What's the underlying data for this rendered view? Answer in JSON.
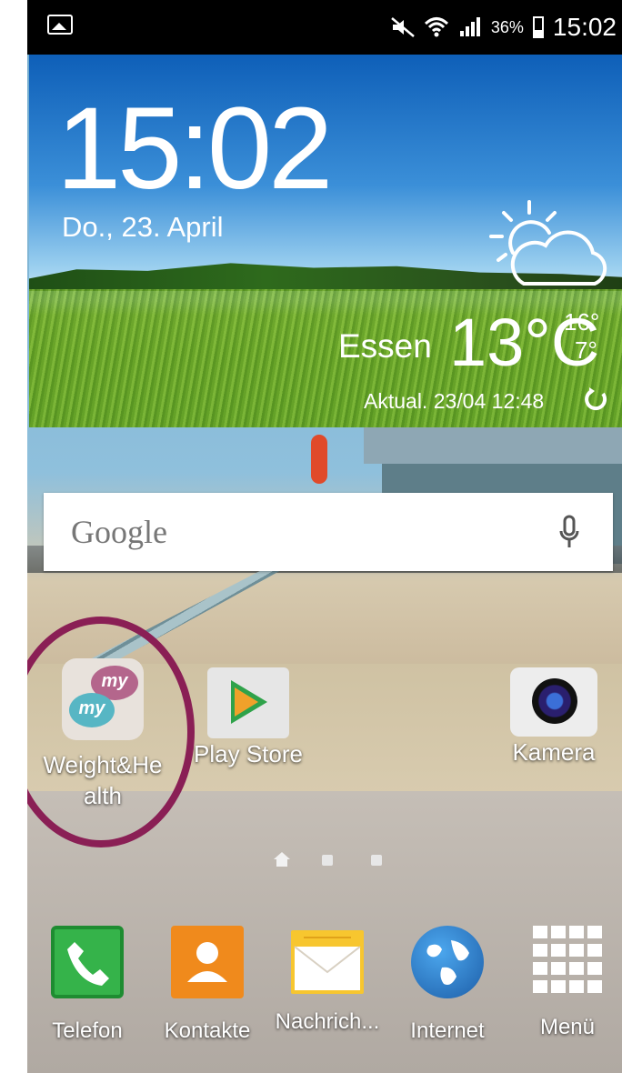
{
  "status_bar": {
    "battery_percent": "36%",
    "time": "15:02",
    "icons": [
      "picture-icon",
      "mute-icon",
      "wifi-icon",
      "signal-icon",
      "battery-icon"
    ]
  },
  "weather_widget": {
    "clock": "15:02",
    "date": "Do., 23. April",
    "city": "Essen",
    "temperature": "13°C",
    "high": "16°",
    "low": "7°",
    "updated": "Aktual. 23/04 12:48",
    "condition_icon": "partly-cloudy-icon"
  },
  "search": {
    "logo": "Google",
    "icon": "mic-icon"
  },
  "apps": [
    {
      "label": "Weight&Health",
      "line1": "Weight&He",
      "line2": "alth",
      "icon": "myhealth-icon",
      "bubble1": "my",
      "bubble2": "my"
    },
    {
      "label": "Play Store",
      "icon": "play-store-icon"
    },
    {
      "label": "Kamera",
      "icon": "camera-icon"
    }
  ],
  "page_indicator": {
    "pages": 3,
    "current": 1
  },
  "dock": [
    {
      "label": "Telefon",
      "icon": "phone-icon"
    },
    {
      "label": "Kontakte",
      "icon": "contacts-icon"
    },
    {
      "label": "Nachrich...",
      "icon": "messages-icon"
    },
    {
      "label": "Internet",
      "icon": "internet-icon"
    },
    {
      "label": "Menü",
      "icon": "apps-menu-icon"
    }
  ],
  "annotation_color": "#8a1f55"
}
